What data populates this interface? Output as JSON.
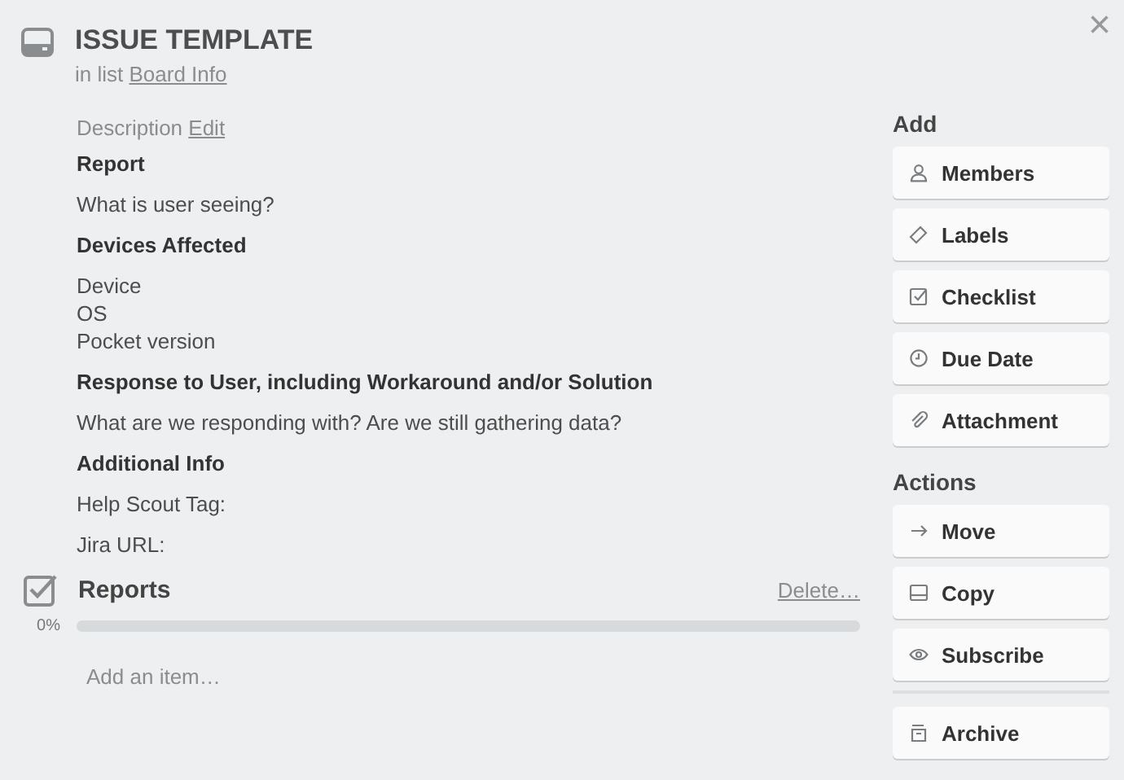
{
  "card": {
    "title": "ISSUE TEMPLATE",
    "list_prefix": "in list",
    "list_name": "Board Info"
  },
  "description": {
    "label": "Description",
    "edit_link": "Edit",
    "blocks": [
      {
        "kind": "heading",
        "lines": [
          "Report"
        ]
      },
      {
        "kind": "text",
        "lines": [
          "What is user seeing?"
        ]
      },
      {
        "kind": "heading",
        "lines": [
          "Devices Affected"
        ]
      },
      {
        "kind": "text",
        "lines": [
          "Device",
          "OS",
          "Pocket version"
        ]
      },
      {
        "kind": "heading",
        "lines": [
          "Response to User, including Workaround and/or Solution"
        ]
      },
      {
        "kind": "text",
        "lines": [
          "What are we responding with? Are we still gathering data?"
        ]
      },
      {
        "kind": "heading",
        "lines": [
          "Additional Info"
        ]
      },
      {
        "kind": "text",
        "lines": [
          "Help Scout Tag:"
        ]
      },
      {
        "kind": "text",
        "lines": [
          "Jira URL:"
        ]
      }
    ]
  },
  "checklist": {
    "title": "Reports",
    "delete_link": "Delete…",
    "reading": "0%",
    "level": 0,
    "placeholder": "Add an item…"
  },
  "sidebar": {
    "add_title": "Add",
    "add_buttons": [
      "Members",
      "Labels",
      "Checklist",
      "Due Date",
      "Attachment"
    ],
    "actions_title": "Actions",
    "action_groups": [
      [
        "Move",
        "Copy",
        "Subscribe"
      ],
      [
        "Archive"
      ]
    ]
  },
  "close": "×"
}
